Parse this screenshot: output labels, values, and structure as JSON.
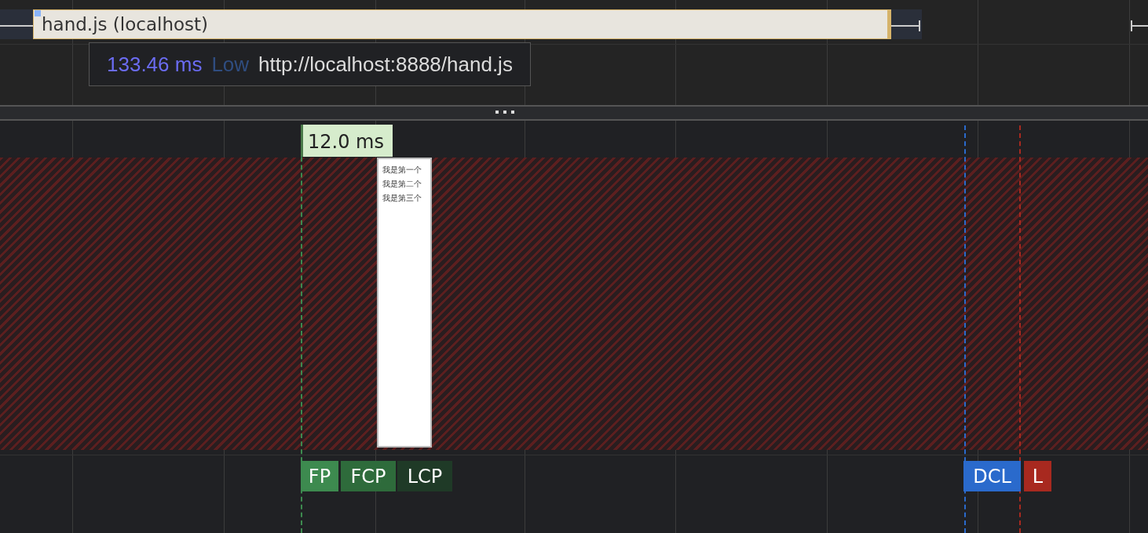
{
  "network_request": {
    "name": "hand.js (localhost)",
    "duration": "133.46 ms",
    "priority": "Low",
    "url": "http://localhost:8888/hand.js"
  },
  "frame": {
    "duration": "12.0 ms"
  },
  "screenshot": {
    "lines": [
      "我是第一个",
      "我是第二个",
      "我是第三个"
    ]
  },
  "markers": [
    {
      "label": "FP",
      "color": "#3d8a4f"
    },
    {
      "label": "FCP",
      "color": "#2e6b3b"
    },
    {
      "label": "LCP",
      "color": "#1f3a27"
    },
    {
      "label": "DCL",
      "color": "#2a6acc"
    },
    {
      "label": "L",
      "color": "#a8291f"
    }
  ]
}
